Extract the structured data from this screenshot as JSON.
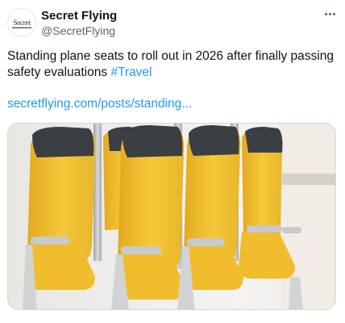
{
  "tweet": {
    "author_name": "Secret Flying",
    "author_handle": "@SecretFlying",
    "avatar_text": "Secret",
    "text_main": "Standing plane seats to roll out in 2026 after finally passing safety evaluations ",
    "hashtag": "#Travel",
    "link": "secretflying.com/posts/standing...",
    "more_icon": "more-horizontal-icon"
  },
  "colors": {
    "link": "#1d9bf0",
    "seat_yellow": "#f2c230",
    "headrest": "#3b3e42",
    "frame": "#c8c9cb"
  }
}
